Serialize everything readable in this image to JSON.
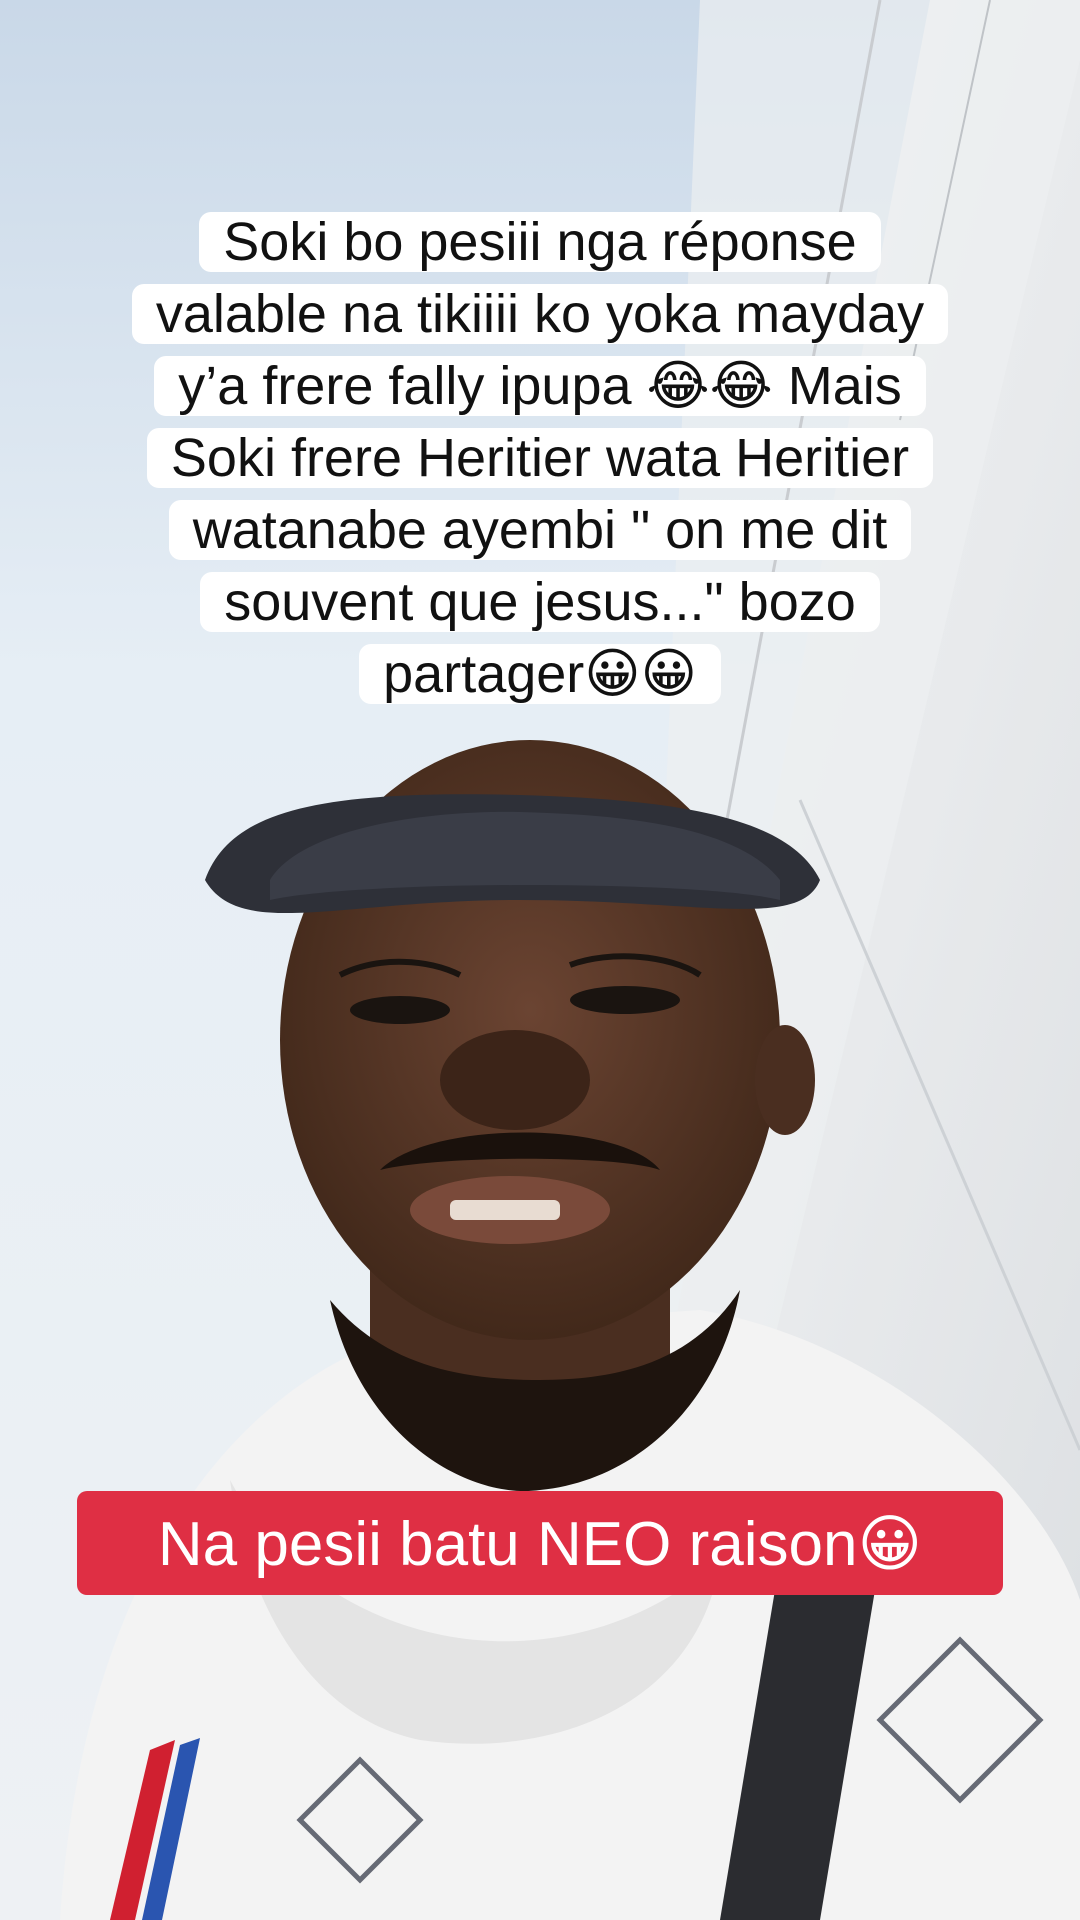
{
  "caption_top": {
    "text": "Soki bo pesiii nga réponse valable na tikiiii ko yoka mayday y’a frere fally ipupa 😂😂 Mais Soki frere Heritier wata Heritier watanabe ayembi \" on me dit souvent que jesus...\" bozo partager😀😀"
  },
  "banner": {
    "text": "Na pesii batu NEO raison😀",
    "color": "#df2f44"
  },
  "scene": {
    "sky": "#e6eef5",
    "wall": "#f2f4f6",
    "cap": "#2e3038",
    "skin": "#5a3a2a",
    "hoodie": "#f3f3f3"
  }
}
